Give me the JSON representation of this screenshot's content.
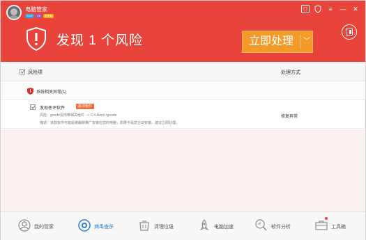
{
  "app": {
    "title": "电脑管家",
    "badges": [
      "SVIP",
      "V6",
      "★★★"
    ]
  },
  "window_controls": [
    "skin-icon",
    "shield-small-icon",
    "menu-icon",
    "minimize-icon",
    "close-icon"
  ],
  "header": {
    "headline": "发现 1 个风险",
    "fix_button": "立即处理",
    "fix_dropdown": "﹀"
  },
  "table": {
    "col_risk": "风险项",
    "col_action": "处理方式",
    "group": {
      "label": "系统相关异常(1)"
    },
    "items": [
      {
        "name": "发现恶评软件",
        "tag": "恶评软件",
        "risk": "风险：goode及附带相关组件 --> C:\\Users\\      \\goode",
        "desc": "描述：该款软件可能是被静默推广安装在您的电脑，如果不是您主动安装，建议立即处理。",
        "action": "修复异常"
      }
    ]
  },
  "nav": [
    {
      "label": "我的管家",
      "icon": "home-icon"
    },
    {
      "label": "病毒查杀",
      "icon": "virus-scan-icon",
      "active": true
    },
    {
      "label": "清理垃圾",
      "icon": "trash-clean-icon"
    },
    {
      "label": "电脑加速",
      "icon": "rocket-icon"
    },
    {
      "label": "软件分析",
      "icon": "software-analysis-icon"
    },
    {
      "label": "工具箱",
      "icon": "toolbox-icon"
    }
  ],
  "colors": {
    "header_red": "#e9443b",
    "fix_orange": "#f39a2b",
    "active_blue": "#2e7bd0"
  }
}
